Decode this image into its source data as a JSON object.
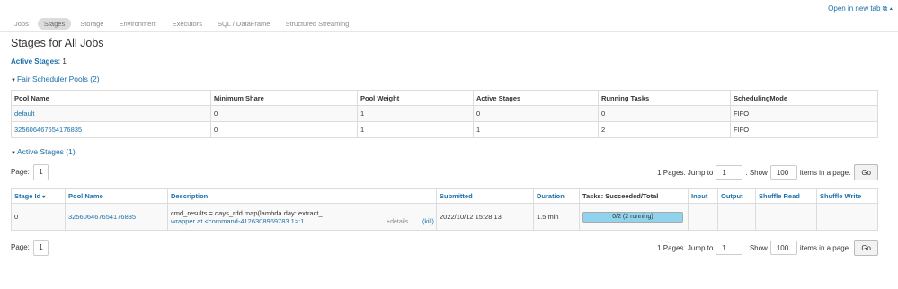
{
  "header": {
    "open_new_tab": "Open in new tab",
    "tabs": [
      "Jobs",
      "Stages",
      "Storage",
      "Environment",
      "Executors",
      "SQL / DataFrame",
      "Structured Streaming"
    ],
    "active_tab": "Stages"
  },
  "page": {
    "title": "Stages for All Jobs",
    "active_stages_label": "Active Stages:",
    "active_stages_count": "1"
  },
  "pools": {
    "heading": "Fair Scheduler Pools (2)",
    "columns": [
      "Pool Name",
      "Minimum Share",
      "Pool Weight",
      "Active Stages",
      "Running Tasks",
      "SchedulingMode"
    ],
    "rows": [
      [
        "default",
        "0",
        "1",
        "0",
        "0",
        "FIFO"
      ],
      [
        "325606467654176835",
        "0",
        "1",
        "1",
        "2",
        "FIFO"
      ]
    ]
  },
  "active_stages": {
    "heading": "Active Stages (1)",
    "columns": [
      "Stage Id",
      "Pool Name",
      "Description",
      "Submitted",
      "Duration",
      "Tasks: Succeeded/Total",
      "Input",
      "Output",
      "Shuffle Read",
      "Shuffle Write"
    ],
    "rows": [
      {
        "stage_id": "0",
        "pool_name": "325606467654176835",
        "description": "cmd_results = days_rdd.map(lambda day: extract_...",
        "callsite": "wrapper at <command-4126308969783 1>:1",
        "details": "+details",
        "kill": "(kill)",
        "submitted": "2022/10/12 15:28:13",
        "duration": "1.5 min",
        "tasks_text": "0/2 (2 running)",
        "tasks_succeeded_fraction": 0,
        "input": "",
        "output": "",
        "shuffle_read": "",
        "shuffle_write": ""
      }
    ]
  },
  "pagination": {
    "page_label": "Page:",
    "page_value": "1",
    "pages_text": "1 Pages. Jump to",
    "jump_value": "1",
    "show_label": ". Show",
    "show_value": "100",
    "items_text": "items in a page.",
    "go_label": "Go"
  }
}
